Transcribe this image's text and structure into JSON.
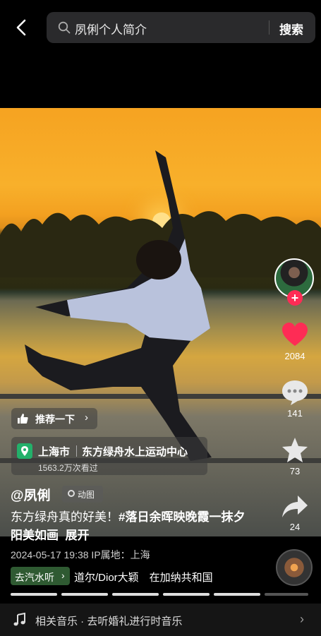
{
  "search": {
    "query": "夙俐个人简介",
    "button": "搜索"
  },
  "video": {
    "recommend_label": "推荐一下",
    "location": {
      "city": "上海市",
      "place": "东方绿舟水上运动中心",
      "views": "1563.2万次看过"
    },
    "author": "@夙俐",
    "dynamic_label": "动图",
    "description_plain": "东方绿舟真的好美！",
    "description_tag": "#落日余晖映晚霞一抹夕阳美如画",
    "expand_label": "展开",
    "meta": "2024-05-17 19:38 IP属地：上海",
    "music_chip": "去汽水听",
    "music_track": "道尔/Dior大颖　在加纳共和国"
  },
  "actions": {
    "likes": "2084",
    "comments": "141",
    "favorites": "73",
    "shares": "24"
  },
  "colors": {
    "like": "#fe2c55",
    "music_chip": "#2f5a32"
  },
  "bottom": {
    "text": "相关音乐 · 去听婚礼进行时音乐"
  }
}
